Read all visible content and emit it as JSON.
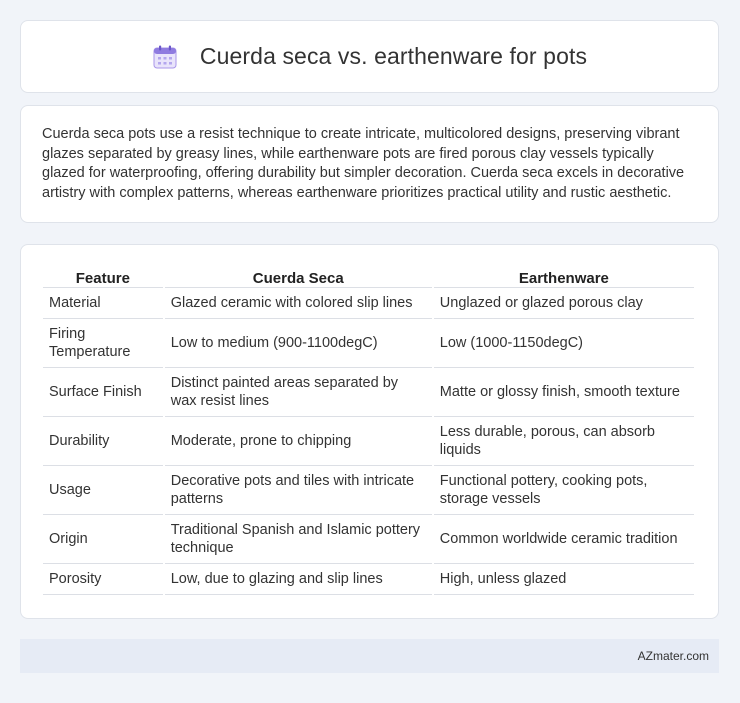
{
  "header": {
    "title": "Cuerda seca vs. earthenware for pots",
    "icon": "calendar-icon"
  },
  "intro": {
    "text": "Cuerda seca pots use a resist technique to create intricate, multicolored designs, preserving vibrant glazes separated by greasy lines, while earthenware pots are fired porous clay vessels typically glazed for waterproofing, offering durability but simpler decoration. Cuerda seca excels in decorative artistry with complex patterns, whereas earthenware prioritizes practical utility and rustic aesthetic."
  },
  "table": {
    "headers": [
      "Feature",
      "Cuerda Seca",
      "Earthenware"
    ],
    "rows": [
      [
        "Material",
        "Glazed ceramic with colored slip lines",
        "Unglazed or glazed porous clay"
      ],
      [
        "Firing Temperature",
        "Low to medium (900-1100degC)",
        "Low (1000-1150degC)"
      ],
      [
        "Surface Finish",
        "Distinct painted areas separated by wax resist lines",
        "Matte or glossy finish, smooth texture"
      ],
      [
        "Durability",
        "Moderate, prone to chipping",
        "Less durable, porous, can absorb liquids"
      ],
      [
        "Usage",
        "Decorative pots and tiles with intricate patterns",
        "Functional pottery, cooking pots, storage vessels"
      ],
      [
        "Origin",
        "Traditional Spanish and Islamic pottery technique",
        "Common worldwide ceramic tradition"
      ],
      [
        "Porosity",
        "Low, due to glazing and slip lines",
        "High, unless glazed"
      ]
    ]
  },
  "footer": {
    "text": "AZmater.com"
  }
}
